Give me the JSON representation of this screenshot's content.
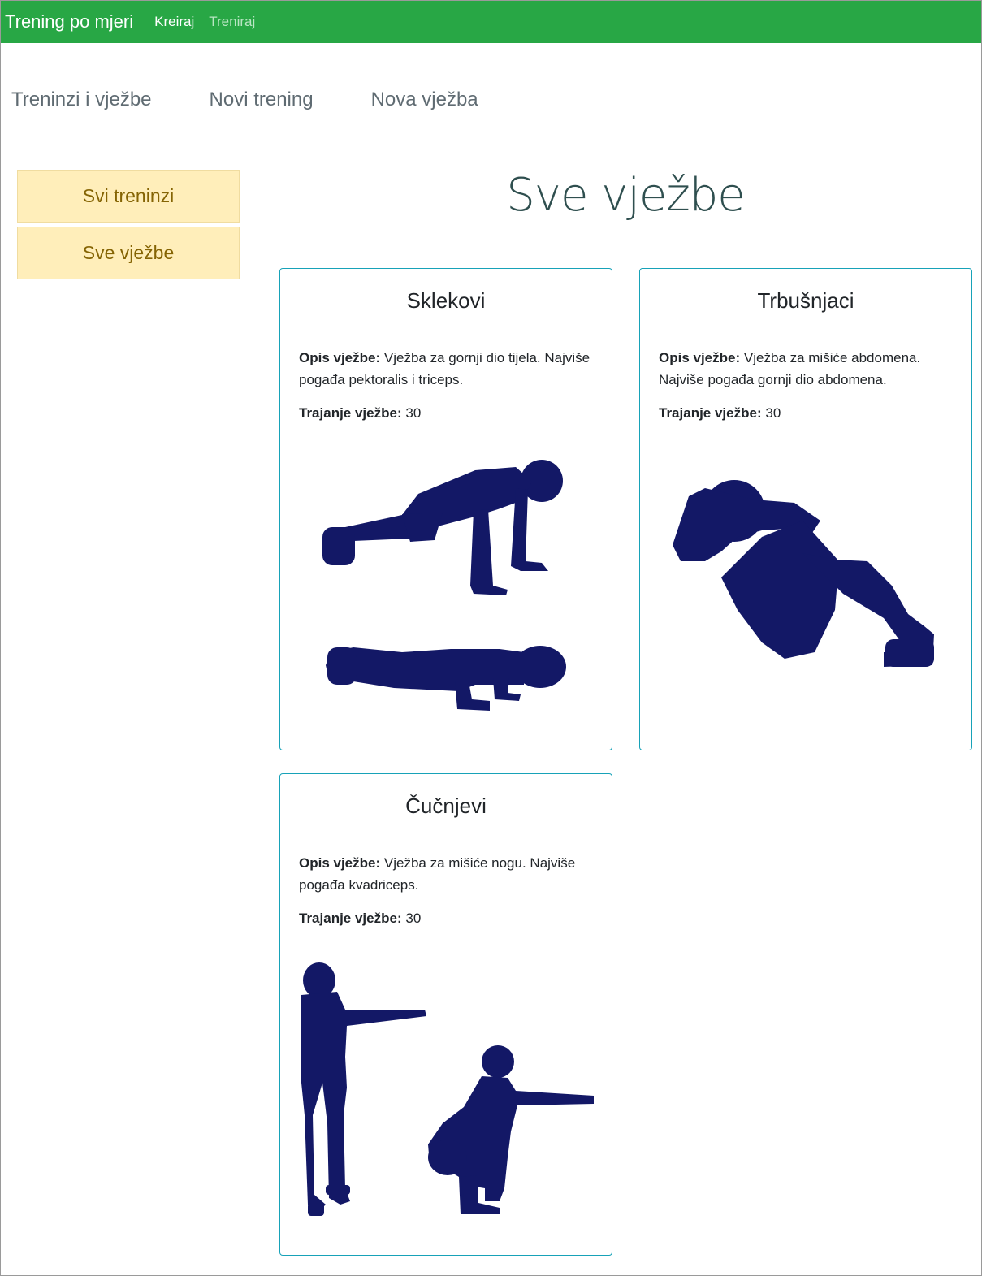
{
  "colors": {
    "brand": "#28a745",
    "figure": "#131866",
    "accent": "#17a2b8",
    "sidebar_button_bg": "#ffeeba"
  },
  "navbar": {
    "brand": "Trening po mjeri",
    "links": [
      {
        "label": "Kreiraj",
        "state": "active"
      },
      {
        "label": "Treniraj",
        "state": "muted"
      }
    ]
  },
  "subnav": {
    "items": [
      "Treninzi i vježbe",
      "Novi trening",
      "Nova vježba"
    ]
  },
  "sidebar": {
    "buttons": [
      "Svi treninzi",
      "Sve vježbe"
    ]
  },
  "main": {
    "title": "Sve vježbe",
    "cards": [
      {
        "title": "Sklekovi",
        "desc_label": "Opis vježbe:",
        "desc": "Vježba za gornji dio tijela. Najviše pogađa pektoralis i triceps.",
        "dur_label": "Trajanje vježbe:",
        "dur": "30",
        "image": "push-up-illustration"
      },
      {
        "title": "Trbušnjaci",
        "desc_label": "Opis vježbe:",
        "desc": "Vježba za mišiće abdomena. Najviše pogađa gornji dio abdomena.",
        "dur_label": "Trajanje vježbe:",
        "dur": "30",
        "image": "sit-up-illustration"
      },
      {
        "title": "Čučnjevi",
        "desc_label": "Opis vježbe:",
        "desc": "Vježba za mišiće nogu. Najviše pogađa kvadriceps.",
        "dur_label": "Trajanje vježbe:",
        "dur": "30",
        "image": "squat-illustration"
      }
    ]
  }
}
